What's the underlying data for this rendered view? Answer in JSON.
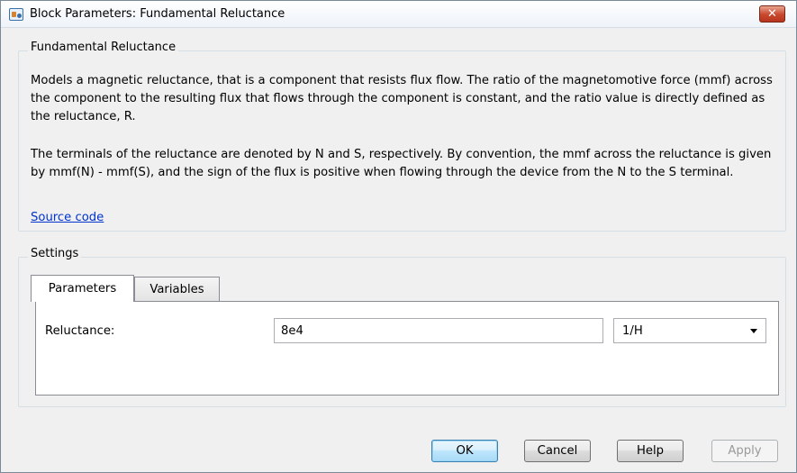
{
  "window": {
    "title": "Block Parameters: Fundamental Reluctance",
    "close_glyph": "✕"
  },
  "description_group": {
    "title": "Fundamental Reluctance",
    "paragraph1": "Models a magnetic reluctance, that is a component that resists flux flow. The ratio of the magnetomotive force (mmf) across the component to the resulting flux that flows through the component is constant, and the ratio value is directly defined as the reluctance, R.",
    "paragraph2": "The terminals of the reluctance are denoted by N and S, respectively. By convention, the mmf across the reluctance is given by mmf(N) - mmf(S), and the sign of the flux is positive when flowing through the device from the N to the S terminal.",
    "link": "Source code"
  },
  "settings": {
    "title": "Settings",
    "tabs": [
      {
        "label": "Parameters",
        "active": true
      },
      {
        "label": "Variables",
        "active": false
      }
    ],
    "parameters": {
      "reluctance_label": "Reluctance:",
      "reluctance_value": "8e4",
      "reluctance_unit": "1/H"
    }
  },
  "buttons": {
    "ok": "OK",
    "cancel": "Cancel",
    "help": "Help",
    "apply": "Apply"
  },
  "colors": {
    "link": "#0033cc",
    "close_button": "#c7462c"
  }
}
